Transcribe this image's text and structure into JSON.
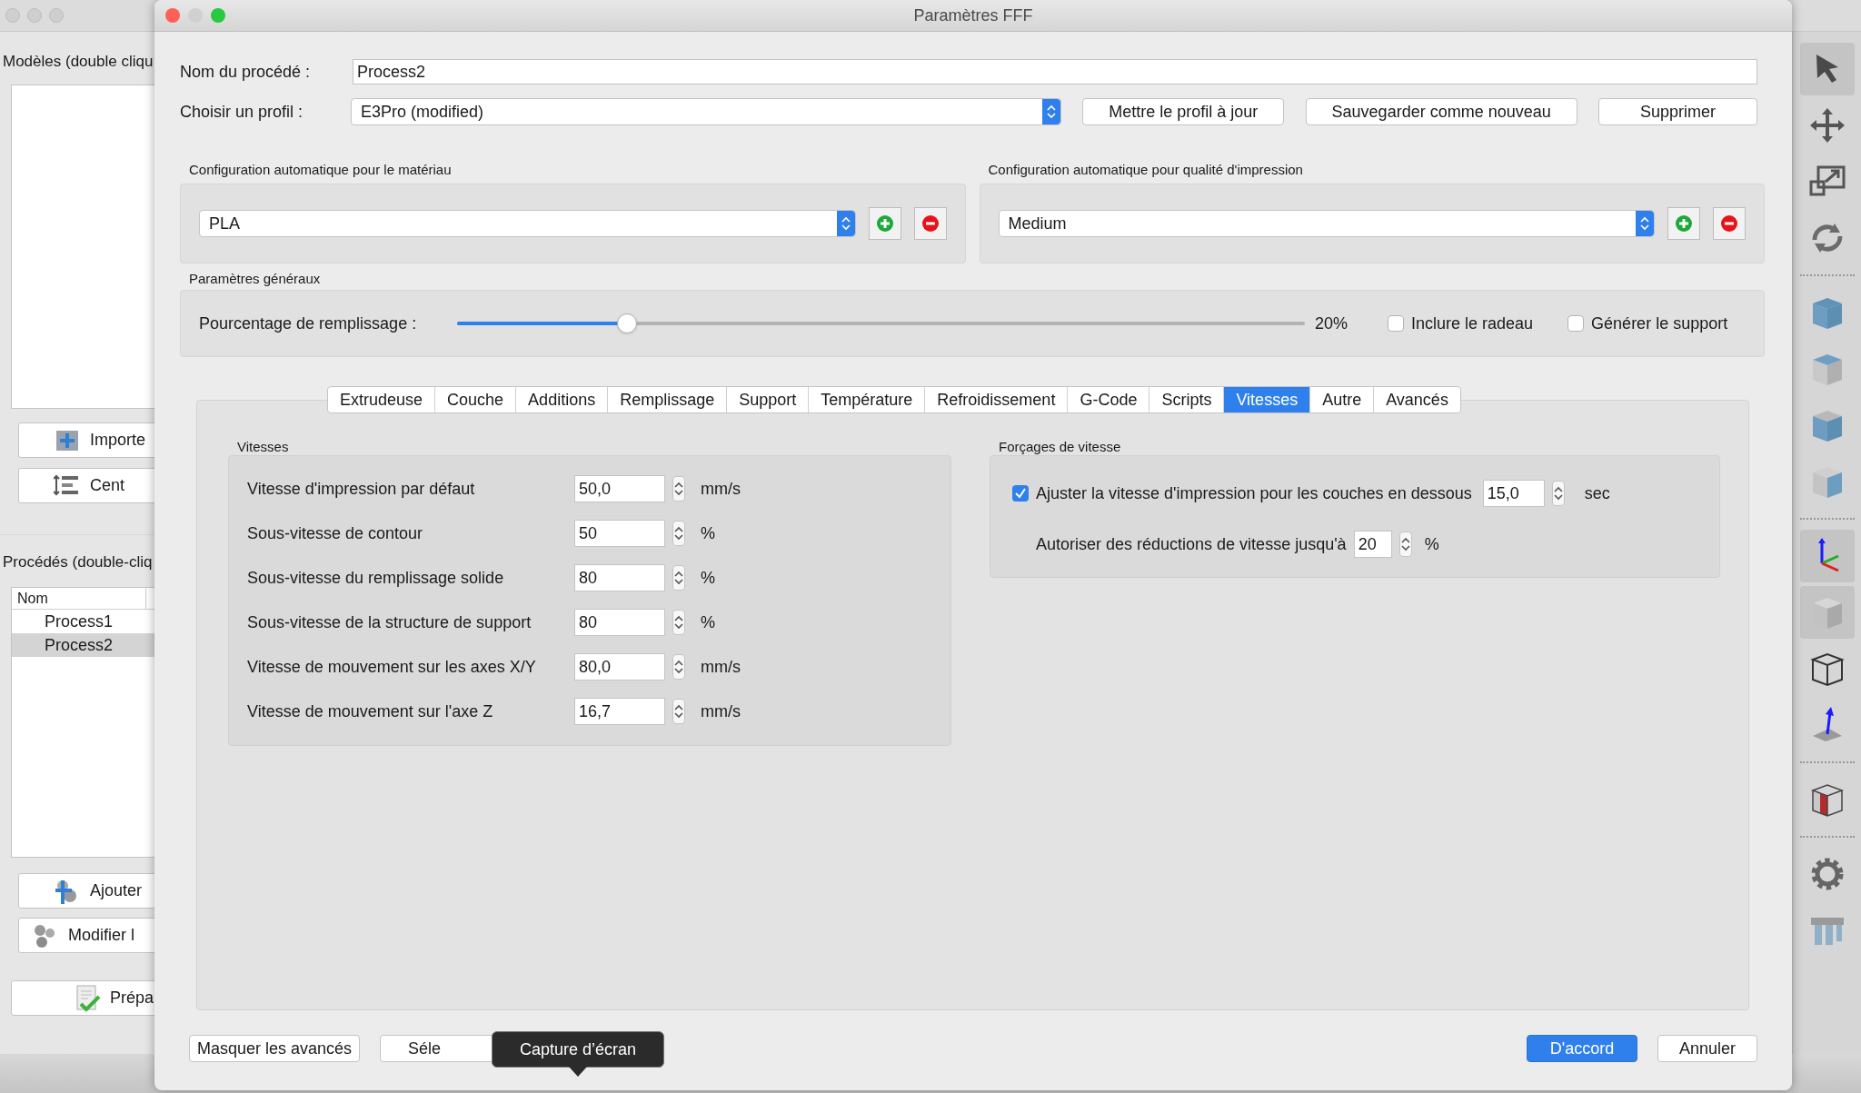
{
  "background_app": {
    "models_label": "Modèles (double cliqu",
    "models_buttons": [
      {
        "label": "Importe"
      },
      {
        "label": "Cent"
      }
    ],
    "processes_label": "Procédés (double-cliq",
    "process_table": {
      "columns": [
        "Nom"
      ],
      "rows": [
        {
          "cells": [
            "Process1"
          ],
          "selected": false
        },
        {
          "cells": [
            "Process2"
          ],
          "selected": true
        }
      ]
    },
    "process_buttons": [
      {
        "label": "Ajouter"
      },
      {
        "label": "Modifier l"
      }
    ],
    "prepare_button": {
      "label": "Prépa"
    },
    "toolbar_groups": [
      [
        {
          "selected": true
        },
        {
          "selected": false
        },
        {
          "selected": false
        },
        {
          "selected": false
        }
      ],
      [
        {
          "selected": false
        },
        {
          "selected": false
        },
        {
          "selected": false
        },
        {
          "selected": false
        }
      ],
      [
        {
          "selected": true
        },
        {
          "selected": true
        },
        {
          "selected": false
        },
        {
          "selected": false
        }
      ],
      [
        {
          "selected": false
        }
      ],
      [
        {
          "selected": false
        },
        {
          "selected": false
        }
      ]
    ]
  },
  "dialog": {
    "title": "Paramètres FFF",
    "name_label": "Nom du procédé :",
    "name_value": "Process2",
    "profile_label": "Choisir un profil :",
    "profile_value": "E3Pro (modified)",
    "profile_buttons": [
      "Mettre le profil à jour",
      "Sauvegarder comme nouveau",
      "Supprimer"
    ],
    "auto_config": [
      {
        "title": "Configuration automatique pour le matériau",
        "value": "PLA"
      },
      {
        "title": "Configuration automatique pour qualité d'impression",
        "value": "Medium"
      }
    ],
    "general": {
      "title": "Paramètres généraux",
      "infill_label": "Pourcentage de remplissage :",
      "infill": {
        "level": 0.2
      },
      "infill_reading": "20%",
      "checkboxes": [
        {
          "label": "Inclure le radeau",
          "checked": false
        },
        {
          "label": "Générer le support",
          "checked": false
        }
      ]
    },
    "tabs": [
      {
        "label": "Extrudeuse",
        "selected": false
      },
      {
        "label": "Couche",
        "selected": false
      },
      {
        "label": "Additions",
        "selected": false
      },
      {
        "label": "Remplissage",
        "selected": false
      },
      {
        "label": "Support",
        "selected": false
      },
      {
        "label": "Température",
        "selected": false
      },
      {
        "label": "Refroidissement",
        "selected": false
      },
      {
        "label": "G-Code",
        "selected": false
      },
      {
        "label": "Scripts",
        "selected": false
      },
      {
        "label": "Vitesses",
        "selected": true
      },
      {
        "label": "Autre",
        "selected": false
      },
      {
        "label": "Avancés",
        "selected": false
      }
    ],
    "speeds": {
      "title": "Vitesses",
      "rows": [
        {
          "label": "Vitesse d'impression par défaut",
          "value": "50,0",
          "unit": "mm/s"
        },
        {
          "label": "Sous-vitesse de contour",
          "value": "50",
          "unit": "%"
        },
        {
          "label": "Sous-vitesse du remplissage solide",
          "value": "80",
          "unit": "%"
        },
        {
          "label": "Sous-vitesse de la structure de support",
          "value": "80",
          "unit": "%"
        },
        {
          "label": "Vitesse de mouvement sur les axes X/Y",
          "value": "80,0",
          "unit": "mm/s"
        },
        {
          "label": "Vitesse de mouvement sur l'axe Z",
          "value": "16,7",
          "unit": "mm/s"
        }
      ]
    },
    "overrides": {
      "title": "Forçages de vitesse",
      "adjust": {
        "label": "Ajuster la vitesse d'impression pour les couches en dessous",
        "checked": true,
        "value": "15,0",
        "unit": "sec"
      },
      "reduction": {
        "label": "Autoriser des réductions de vitesse jusqu'à",
        "value": "20",
        "unit": "%"
      }
    },
    "footer": {
      "left_buttons": [
        "Masquer les avancés",
        "Séle"
      ],
      "tooltip": "Capture d’écran",
      "ok": "D'accord",
      "cancel": "Annuler"
    }
  }
}
